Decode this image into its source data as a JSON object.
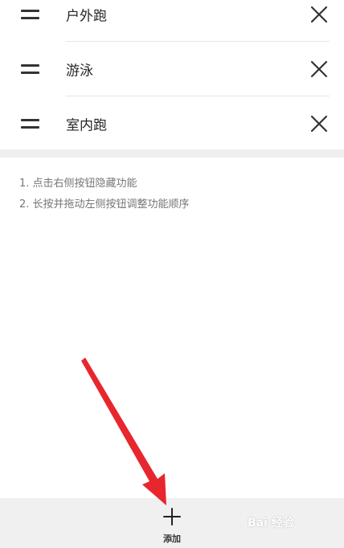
{
  "list": {
    "items": [
      {
        "label": "户外跑"
      },
      {
        "label": "游泳"
      },
      {
        "label": "室内跑"
      }
    ]
  },
  "tips": [
    "1. 点击右侧按钮隐藏功能",
    "2. 长按并拖动左侧按钮调整功能顺序"
  ],
  "bottom_bar": {
    "add_label": "添加"
  },
  "watermark": {
    "text": "Bai 经验"
  },
  "colors": {
    "arrow": "#e8262d",
    "background": "#ffffff",
    "bottom_bar": "#f0f0f0"
  },
  "icons": {
    "drag": "drag-handle-icon",
    "close": "close-icon",
    "add": "plus-icon"
  }
}
